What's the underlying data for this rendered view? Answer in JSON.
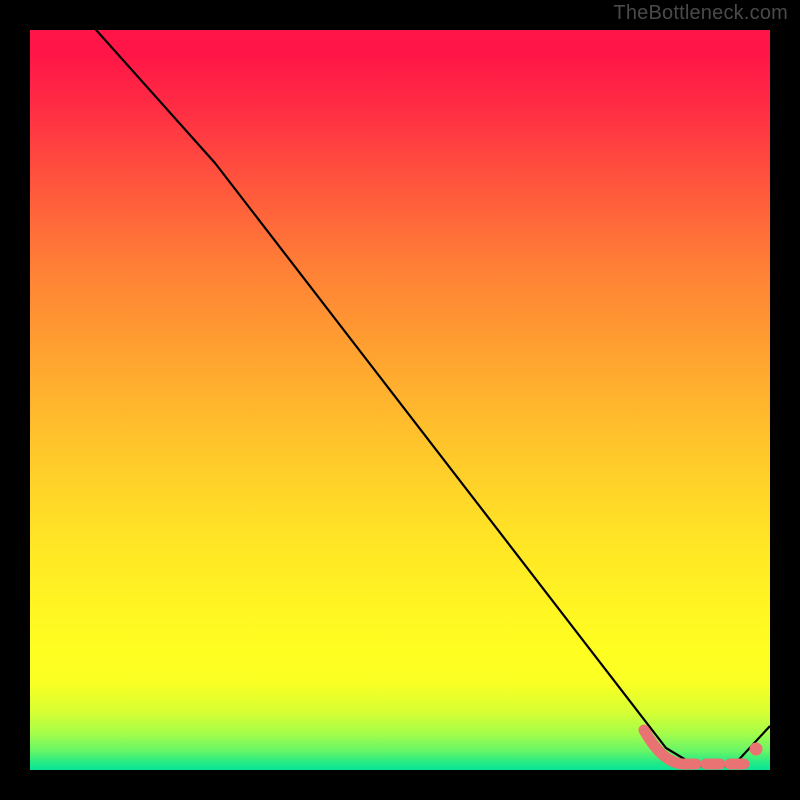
{
  "watermark": "TheBottleneck.com",
  "colors": {
    "frame": "#000000",
    "curve": "#000000",
    "marker": "#e97373"
  },
  "chart_data": {
    "type": "line",
    "x": [
      0,
      25,
      86,
      90,
      93,
      95,
      100
    ],
    "values": [
      110,
      82,
      3,
      0.5,
      0.5,
      0.5,
      6
    ],
    "xlim": [
      0,
      100
    ],
    "ylim": [
      0,
      100
    ],
    "title": "",
    "xlabel": "",
    "ylabel": "",
    "notes": "Vertical heat gradient background; salmon markers highlight the flat minimum around x≈86–95 with a trailing dot near x≈95."
  }
}
